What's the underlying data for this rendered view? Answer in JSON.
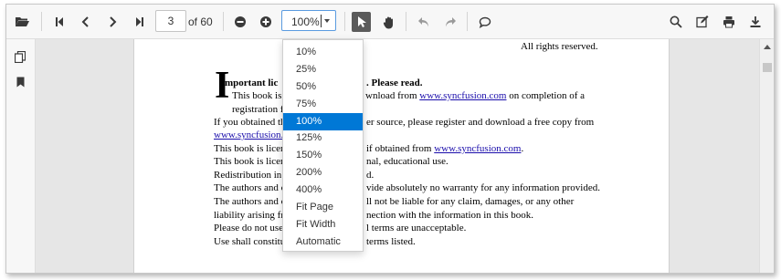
{
  "toolbar": {
    "open_icon": "open-folder-icon",
    "first_icon": "first-page-icon",
    "prev_icon": "previous-page-icon",
    "next_icon": "next-page-icon",
    "last_icon": "last-page-icon",
    "current_page": "3",
    "page_of": "of 60",
    "zoom_out_icon": "zoom-out-icon",
    "zoom_in_icon": "zoom-in-icon",
    "zoom_value": "100%",
    "selection_icon": "text-select-icon",
    "pan_icon": "pan-icon",
    "undo_icon": "undo-icon",
    "redo_icon": "redo-icon",
    "comment_icon": "comment-icon",
    "search_icon": "search-icon",
    "annotate_icon": "edit-annotation-icon",
    "print_icon": "print-icon",
    "download_icon": "download-icon"
  },
  "sidebar": {
    "thumbnails_icon": "page-thumbnails-icon",
    "bookmarks_icon": "bookmark-icon"
  },
  "zoom_menu": {
    "options": [
      "10%",
      "25%",
      "50%",
      "75%",
      "100%",
      "125%",
      "150%",
      "200%",
      "400%",
      "Fit Page",
      "Fit Width",
      "Automatic"
    ],
    "selected": "100%"
  },
  "document": {
    "rights": "All rights reserved.",
    "dropcap": "I",
    "heading_start": "mportant lic",
    "heading_end": ". Please read.",
    "l1_start": "This book is ",
    "l1_mid": "wnload from ",
    "l1_link": "www.syncfusion.com",
    "l1_end": " on completion of a",
    "l2": "registration f",
    "l3_start": "If you obtained th",
    "l3_end": "er source, please register and download a free copy from",
    "l4_link": "www.syncfusion.c",
    "l5_start": "This book is licen",
    "l5_mid": "if obtained from ",
    "l5_link": "www.syncfusion.com",
    "l5_end": ".",
    "l6_start": "This book is licen",
    "l6_end": "nal, educational use.",
    "l7_start": "Redistribution in a",
    "l7_end": "d.",
    "l8_start": "The authors and c",
    "l8_end": "vide absolutely no warranty for any information provided.",
    "l9_start": "The authors and c",
    "l9_end": "ll not be liable for any claim, damages, or any other",
    "l10_start": "liability arising fro",
    "l10_end": "nection with the information in this book.",
    "l11_start": "Please do not use",
    "l11_end": "l terms are unacceptable.",
    "l12_start": "Use shall constitu",
    "l12_end": "terms listed."
  }
}
